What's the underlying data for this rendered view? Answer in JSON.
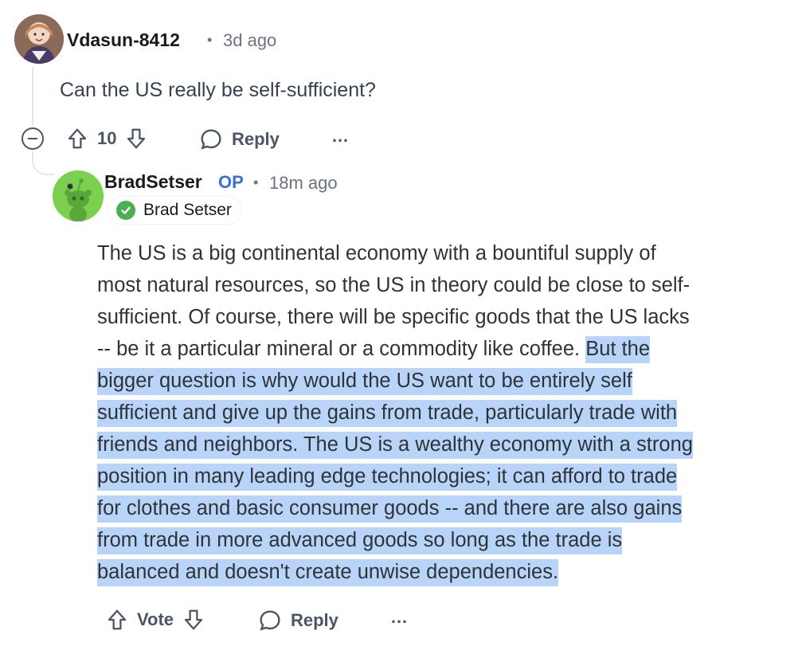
{
  "parent_comment": {
    "username": "Vdasun-8412",
    "separator": "•",
    "time_ago": "3d ago",
    "body": "Can the US really be self-sufficient?",
    "vote_count": "10",
    "reply_label": "Reply",
    "more_label": "…",
    "avatar_icon": "anime-avatar-icon"
  },
  "reply_comment": {
    "username": "BradSetser",
    "op_tag": "OP",
    "separator": "•",
    "time_ago": "18m ago",
    "flair_text": "Brad Setser",
    "avatar_icon": "snoo-avatar-icon",
    "body_lines": [
      {
        "pre": "The US is a big continental economy with a bountiful supply of",
        "hl": ""
      },
      {
        "pre": "most natural resources, so the US in theory could be close to self-",
        "hl": ""
      },
      {
        "pre": "sufficient. Of course, there will be specific goods that the US lacks",
        "hl": ""
      },
      {
        "pre": "-- be it a particular mineral or a commodity like coffee. ",
        "hl": "But the"
      },
      {
        "pre": "",
        "hl": "bigger question is why would the US want to be entirely self"
      },
      {
        "pre": "",
        "hl": "sufficient and give up the gains from trade, particularly trade with"
      },
      {
        "pre": "",
        "hl": "friends and neighbors. The US is a wealthy economy with a strong"
      },
      {
        "pre": "",
        "hl": "position in many leading edge technologies; it can afford to trade"
      },
      {
        "pre": "",
        "hl": "for clothes and basic consumer goods -- and there are also gains"
      },
      {
        "pre": "",
        "hl": "from trade in more advanced goods so long as the trade is"
      },
      {
        "pre": "",
        "hl": "balanced and doesn't create unwise dependencies."
      }
    ],
    "vote_label": "Vote",
    "reply_label": "Reply",
    "more_label": "…"
  },
  "colors": {
    "highlight": "#b8d4f8",
    "op_blue": "#3b6fd4",
    "flair_green": "#4caf50",
    "thread_line": "#e5e7eb"
  }
}
